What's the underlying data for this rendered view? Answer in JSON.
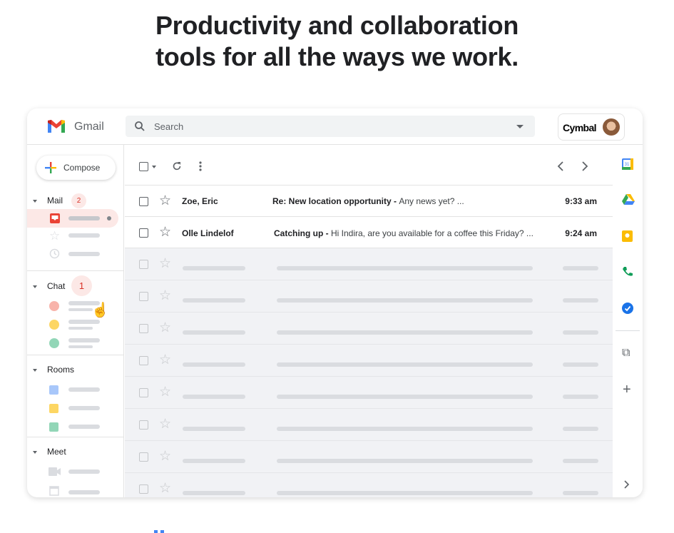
{
  "headline": {
    "line1": "Productivity and collaboration",
    "line2": "tools for all the ways we work."
  },
  "header": {
    "app_name": "Gmail",
    "search_placeholder": "Search",
    "account_brand": "Cymbal"
  },
  "sidebar": {
    "compose_label": "Compose",
    "sections": [
      {
        "label": "Mail",
        "badge": "2"
      },
      {
        "label": "Chat",
        "badge": "1"
      },
      {
        "label": "Rooms"
      },
      {
        "label": "Meet"
      }
    ]
  },
  "emails": [
    {
      "sender": "Zoe, Eric",
      "subject": "Re: New location opportunity",
      "snippet": "Any news yet? ...",
      "time": "9:33 am"
    },
    {
      "sender": "Olle Lindelof",
      "subject": "Catching up",
      "snippet": "Hi Indira, are you available for a coffee this Friday? ...",
      "time": "9:24 am"
    }
  ],
  "separator": " - ",
  "placeholder_rows": 8,
  "colors": {
    "accent": "#ea4335",
    "badge_bg": "#fce8e6",
    "placeholder_bg": "#f1f2f5"
  }
}
